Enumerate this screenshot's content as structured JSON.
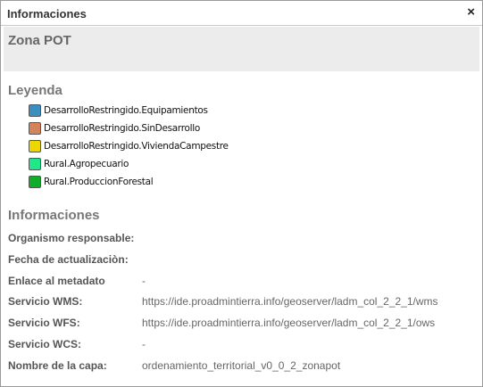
{
  "window": {
    "title": "Informaciones",
    "close": "×"
  },
  "header": {
    "title": "Zona POT"
  },
  "legend": {
    "heading": "Leyenda",
    "items": [
      {
        "label": "DesarrolloRestringido.Equipamientos",
        "color": "#3a8ec0"
      },
      {
        "label": "DesarrolloRestringido.SinDesarrollo",
        "color": "#d4835a"
      },
      {
        "label": "DesarrolloRestringido.ViviendaCampestre",
        "color": "#ecd800"
      },
      {
        "label": "Rural.Agropecuario",
        "color": "#1fe88a"
      },
      {
        "label": "Rural.ProduccionForestal",
        "color": "#0fae2a"
      }
    ]
  },
  "info": {
    "heading": "Informaciones",
    "rows": [
      {
        "label": "Organismo responsable:",
        "value": ""
      },
      {
        "label": "Fecha de actualizaciòn:",
        "value": ""
      },
      {
        "label": "Enlace al metadato",
        "value": "-"
      },
      {
        "label": "Servicio WMS:",
        "value": "https://ide.proadmintierra.info/geoserver/ladm_col_2_2_1/wms"
      },
      {
        "label": "Servicio WFS:",
        "value": "https://ide.proadmintierra.info/geoserver/ladm_col_2_2_1/ows"
      },
      {
        "label": "Servicio WCS:",
        "value": "-"
      },
      {
        "label": "Nombre de la capa:",
        "value": "ordenamiento_territorial_v0_0_2_zonapot"
      }
    ]
  }
}
